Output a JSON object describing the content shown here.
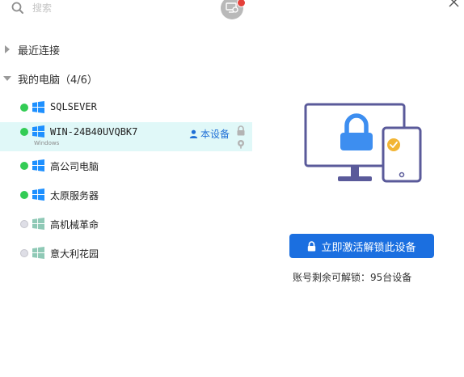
{
  "search": {
    "placeholder": "搜索"
  },
  "groups": {
    "recent": {
      "label": "最近连接",
      "expanded": false
    },
    "mine": {
      "label": "我的电脑（4/6）",
      "expanded": true
    }
  },
  "devices": [
    {
      "name": "SQLSEVER",
      "status": "online",
      "os_icon": "windows-icon"
    },
    {
      "name": "WIN-24B40UVQBK7",
      "status": "online",
      "os_icon": "windows-icon",
      "os_label": "Windows",
      "this_device_label": "本设备",
      "selected": true
    },
    {
      "name": "高公司电脑",
      "status": "online",
      "os_icon": "windows-icon"
    },
    {
      "name": "太原服务器",
      "status": "online",
      "os_icon": "windows-icon"
    },
    {
      "name": "高机械革命",
      "status": "offline",
      "os_icon": "windows-icon"
    },
    {
      "name": "意大利花园",
      "status": "offline",
      "os_icon": "windows-icon"
    }
  ],
  "right_panel": {
    "unlock_button_label": "立即激活解锁此设备",
    "quota_text": "账号剩余可解锁：95台设备"
  },
  "colors": {
    "accent": "#1b6fe0",
    "online": "#33cc55",
    "offline": "#dedee6",
    "selected_row": "#e0f8f8",
    "illustration_stroke": "#5a5a9a",
    "illustration_blue": "#3d8ef0",
    "illustration_check": "#f2b535"
  }
}
